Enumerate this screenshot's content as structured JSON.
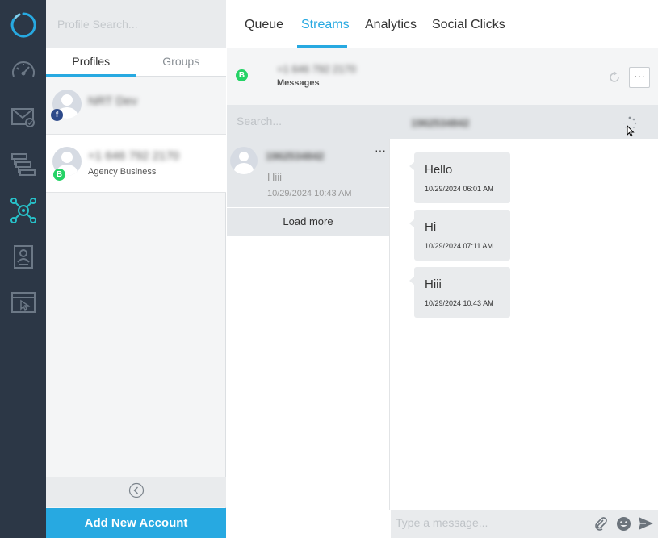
{
  "profiles_panel": {
    "search_placeholder": "Profile Search...",
    "tabs": [
      {
        "label": "Profiles",
        "active": true
      },
      {
        "label": "Groups",
        "active": false
      }
    ],
    "items": [
      {
        "name": "NRT Dev",
        "subtitle": "",
        "network": "facebook",
        "badge": "f"
      },
      {
        "name": "+1 646 792 2170",
        "subtitle": "Agency Business",
        "network": "whatsapp-business",
        "badge": "B"
      }
    ],
    "add_account_label": "Add New Account"
  },
  "topnav": {
    "tabs": [
      {
        "label": "Queue",
        "active": false
      },
      {
        "label": "Streams",
        "active": true
      },
      {
        "label": "Analytics",
        "active": false
      },
      {
        "label": "Social Clicks",
        "active": false
      }
    ]
  },
  "stream": {
    "title": "+1 646 792 2170",
    "subtitle": "Messages",
    "badge": "B",
    "more_label": "···"
  },
  "search": {
    "placeholder": "Search...",
    "conversation_name": "1962534842"
  },
  "conversations": [
    {
      "name": "1962534842",
      "last_message": "Hiii",
      "time": "10/29/2024 10:43 AM",
      "menu": "···"
    }
  ],
  "load_more_label": "Load more",
  "messages": [
    {
      "text": "Hello",
      "time": "10/29/2024 06:01 AM"
    },
    {
      "text": "Hi",
      "time": "10/29/2024 07:11 AM"
    },
    {
      "text": "Hiii",
      "time": "10/29/2024 10:43 AM"
    }
  ],
  "composer": {
    "placeholder": "Type a message..."
  },
  "colors": {
    "rail_bg": "#2c3746",
    "accent": "#27a9e1",
    "whatsapp_green": "#25d366",
    "facebook_blue": "#2d4a8a",
    "active_rail_icon": "#27c1c9"
  },
  "rail_icons": [
    "logo-ring-icon",
    "dashboard-gauge-icon",
    "inbox-mail-icon",
    "workflow-icon",
    "social-network-icon",
    "contacts-icon",
    "browser-click-icon"
  ]
}
